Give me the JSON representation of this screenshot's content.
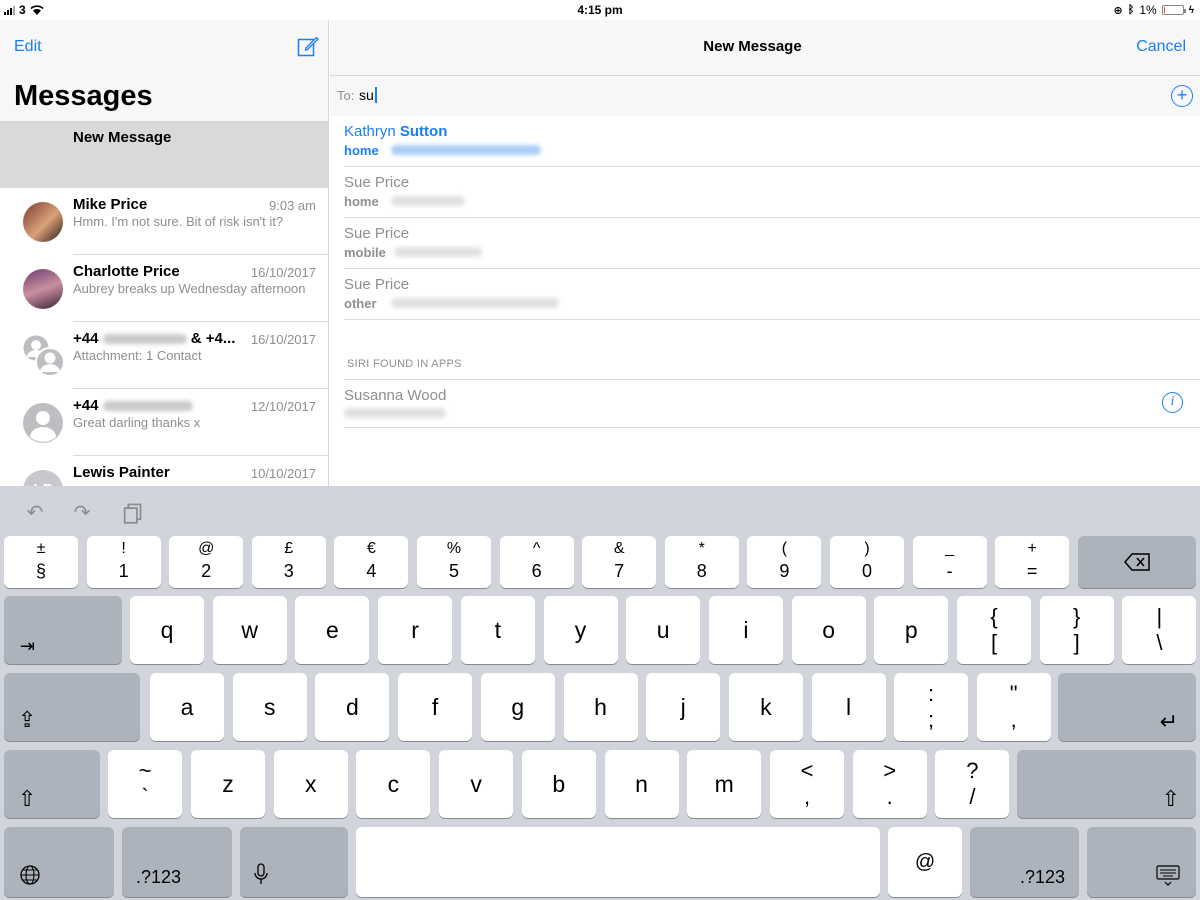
{
  "status": {
    "carrier": "3",
    "time": "4:15 pm",
    "battery": "1%"
  },
  "sidebar": {
    "edit_label": "Edit",
    "title": "Messages",
    "new_message": "New Message",
    "conversations": [
      {
        "name": "Mike Price",
        "date": "9:03 am",
        "preview": "Hmm. I'm not sure. Bit of risk isn't it?"
      },
      {
        "name": "Charlotte Price",
        "date": "16/10/2017",
        "preview": "Aubrey breaks up Wednesday afternoon"
      },
      {
        "name_prefix": "+44",
        "name_suffix": "& +4...",
        "date": "16/10/2017",
        "preview": "Attachment: 1 Contact"
      },
      {
        "name_prefix": "+44",
        "date": "12/10/2017",
        "preview": "Great darling thanks x"
      },
      {
        "name": "Lewis Painter",
        "date": "10/10/2017",
        "initials": "LP"
      }
    ]
  },
  "compose": {
    "title": "New Message",
    "cancel_label": "Cancel",
    "to_label": "To:",
    "to_value": "su",
    "suggestions": [
      {
        "first": "Kathryn",
        "last": "Sutton",
        "kind": "home"
      },
      {
        "first": "Sue",
        "last": "Price",
        "kind": "home"
      },
      {
        "first": "Sue",
        "last": "Price",
        "kind": "mobile"
      },
      {
        "first": "Sue",
        "last": "Price",
        "kind": "other"
      }
    ],
    "siri_header": "SIRI FOUND IN APPS",
    "siri_contact": {
      "first": "Susanna",
      "last": "Wood"
    }
  },
  "keyboard": {
    "number_row": [
      [
        "±",
        "§"
      ],
      [
        "!",
        "1"
      ],
      [
        "@",
        "2"
      ],
      [
        "£",
        "3"
      ],
      [
        "€",
        "4"
      ],
      [
        "%",
        "5"
      ],
      [
        "^",
        "6"
      ],
      [
        "&",
        "7"
      ],
      [
        "*",
        "8"
      ],
      [
        "(",
        "9"
      ],
      [
        ")",
        "0"
      ],
      [
        "_",
        "-"
      ],
      [
        "+",
        "="
      ]
    ],
    "row_q": [
      "q",
      "w",
      "e",
      "r",
      "t",
      "y",
      "u",
      "i",
      "o",
      "p"
    ],
    "row_q_extra": [
      [
        "{",
        "["
      ],
      [
        "}",
        "]"
      ],
      [
        "|",
        "\\"
      ]
    ],
    "row_a": [
      "a",
      "s",
      "d",
      "f",
      "g",
      "h",
      "j",
      "k",
      "l"
    ],
    "row_a_extra": [
      [
        ":",
        ";"
      ],
      [
        "\"",
        ","
      ]
    ],
    "row_z_first": [
      "~",
      "`"
    ],
    "row_z": [
      "z",
      "x",
      "c",
      "v",
      "b",
      "n",
      "m"
    ],
    "row_z_extra": [
      [
        "<",
        ","
      ],
      [
        ">",
        "."
      ],
      [
        "?",
        "/"
      ]
    ],
    "at_key": "@",
    "num_key": ".?123"
  }
}
